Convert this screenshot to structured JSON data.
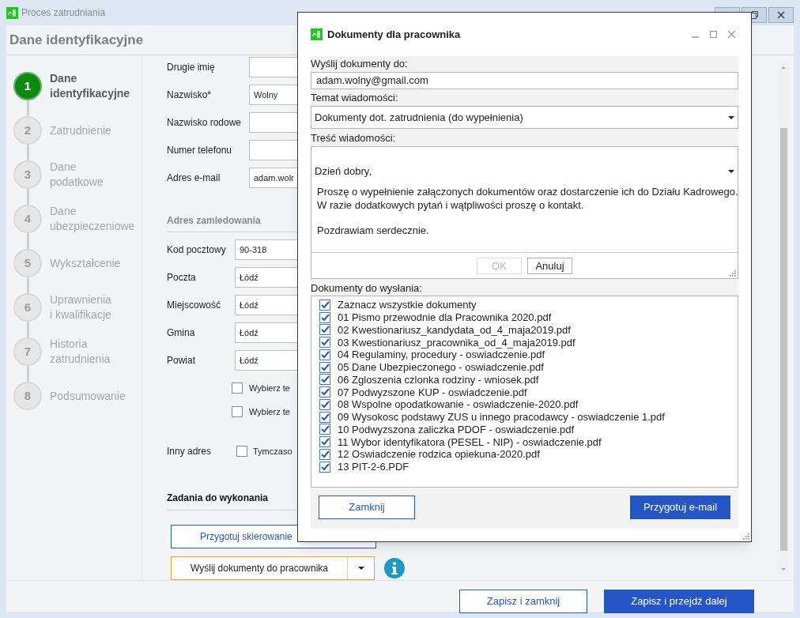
{
  "window": {
    "title": "Proces zatrudniania"
  },
  "header": "Dane identyfikacyjne",
  "steps": [
    {
      "number": "1",
      "lines": [
        "Dane",
        "identyfikacyjne"
      ],
      "selected": true
    },
    {
      "number": "2",
      "lines": [
        "Zatrudnienie"
      ],
      "selected": false
    },
    {
      "number": "3",
      "lines": [
        "Dane",
        "podatkowe"
      ],
      "selected": false
    },
    {
      "number": "4",
      "lines": [
        "Dane",
        "ubezpieczeniowe"
      ],
      "selected": false
    },
    {
      "number": "5",
      "lines": [
        "Wykształcenie"
      ],
      "selected": false
    },
    {
      "number": "6",
      "lines": [
        "Uprawnienia",
        "i kwalifikacje"
      ],
      "selected": false
    },
    {
      "number": "7",
      "lines": [
        "Historia",
        "zatrudnienia"
      ],
      "selected": false
    },
    {
      "number": "8",
      "lines": [
        "Podsumowanie"
      ],
      "selected": false
    }
  ],
  "personal_fields": [
    {
      "label": "Drugie imię"
    },
    {
      "label": "Nazwisko*",
      "value": "Wolny"
    },
    {
      "label": "Nazwisko rodowe"
    },
    {
      "label": "Numer telefonu"
    },
    {
      "label": "Adres e-mail",
      "value": "adam.wolr"
    }
  ],
  "address": {
    "title": "Adres zamledowania",
    "fields": [
      {
        "label": "Kod pocztowy",
        "value": "90-318"
      },
      {
        "label": "Poczta",
        "value": "Łódź"
      },
      {
        "label": "Miejscowość",
        "value": "Łódź"
      },
      {
        "label": "Gmina",
        "value": "Łódź"
      },
      {
        "label": "Powiat",
        "value": "Łódź"
      }
    ],
    "options": [
      {
        "label": "Wybierz te",
        "checked": false
      },
      {
        "label": "Wybierz te",
        "checked": false
      }
    ]
  },
  "other_address": {
    "label": "Inny adres",
    "option": {
      "label": "Tymczaso",
      "checked": false
    }
  },
  "tasks": {
    "title": "Zadania do wykonania",
    "prepare_button": "Przygotuj skierowanie",
    "send_button": "Wyślij dokumenty do pracownika"
  },
  "footer_buttons": [
    {
      "label": "Zapisz i zamknij",
      "kind": "outline"
    },
    {
      "label": "Zapisz i przejdź dalej",
      "kind": "primary"
    }
  ],
  "dialog": {
    "title": "Dokumenty dla pracownika",
    "recipient": {
      "label": "Wyślij dokumenty do:",
      "value": "adam.wolny@gmail.com"
    },
    "subject": {
      "label": "Temat wiadomości:",
      "value": "Dokumenty dot. zatrudnienia (do wypełnienia)"
    },
    "body": {
      "label": "Treść wiadomości:",
      "greeting": "Dzień dobry,",
      "paragraphs": [
        [
          "Proszę o wypełnienie załączonych dokumentów oraz dostarczenie ich do Działu Kadrowego.",
          "W razie dodatkowych pytań i wątpliwości proszę o kontakt."
        ],
        [
          "Pozdrawiam serdecznie."
        ]
      ],
      "ok": {
        "label": "OK",
        "disabled": true
      },
      "cancel": {
        "label": "Anuluj",
        "disabled": false
      }
    },
    "documents_label": "Dokumenty do wysłania:",
    "documents": [
      {
        "label": "Zaznacz wszystkie dokumenty",
        "checked": true
      },
      {
        "label": "01 Pismo przewodnie dla Pracownika 2020.pdf",
        "checked": true
      },
      {
        "label": "02 Kwestionariusz_kandydata_od_4_maja2019.pdf",
        "checked": true
      },
      {
        "label": "03 Kwestionariusz_pracownika_od_4_maja2019.pdf",
        "checked": true
      },
      {
        "label": "04 Regulaminy, procedury - oswiadczenie.pdf",
        "checked": true
      },
      {
        "label": "05 Dane Ubezpieczonego - oswiadczenie.pdf",
        "checked": true
      },
      {
        "label": "06 Zgloszenia czlonka rodziny - wniosek.pdf",
        "checked": true
      },
      {
        "label": "07 Podwyzszone KUP - oswiadczenie.pdf",
        "checked": true
      },
      {
        "label": "08 Wspolne opodatkowanie - oswiadczenie-2020.pdf",
        "checked": true
      },
      {
        "label": "09 Wysokosc podstawy ZUS u innego pracodawcy - oswiadczenie 1.pdf",
        "checked": true
      },
      {
        "label": "10 Podwyzszona zaliczka PDOF - oswiadczenie.pdf",
        "checked": true
      },
      {
        "label": "11 Wybor identyfikatora (PESEL - NIP) - oswiadczenie.pdf",
        "checked": true
      },
      {
        "label": "12 Oswiadczenie rodzica opiekuna-2020.pdf",
        "checked": true
      },
      {
        "label": "13 PIT-2-6.PDF",
        "checked": true
      }
    ],
    "close_button": "Zamknij",
    "prepare_button": "Przygotuj e-mail"
  }
}
